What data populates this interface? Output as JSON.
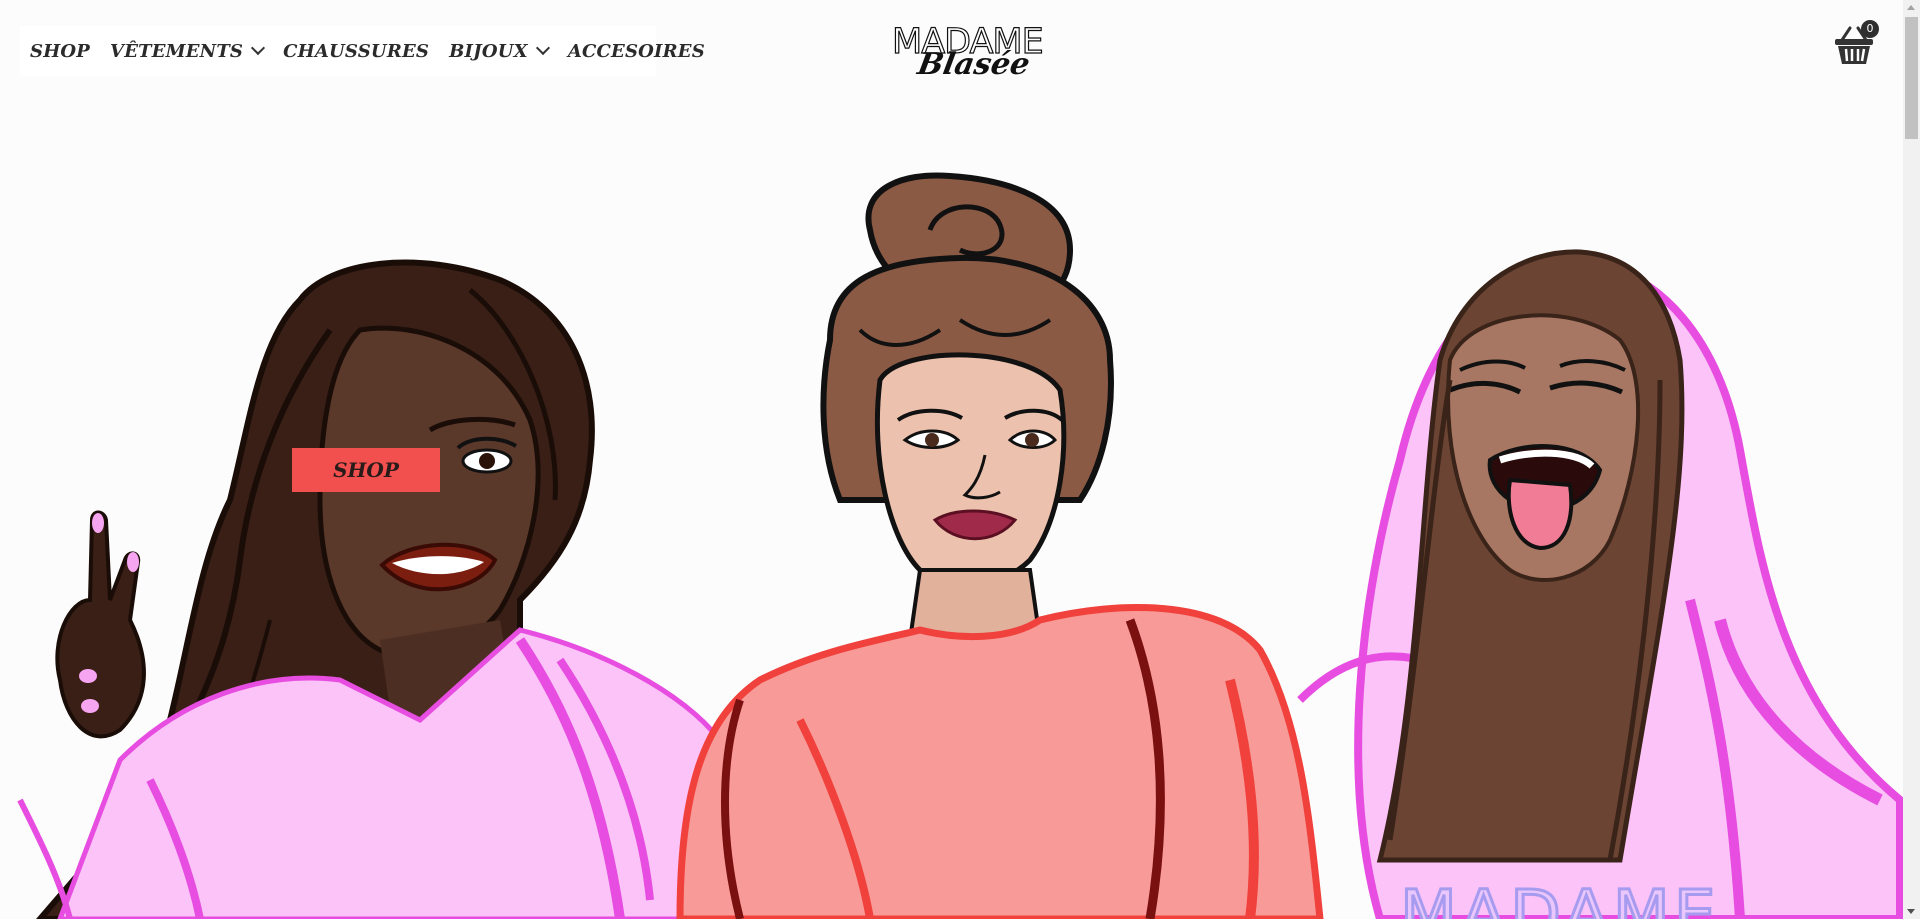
{
  "nav": {
    "items": [
      {
        "label": "SHOP",
        "has_dropdown": false
      },
      {
        "label": "VÊTEMENTS",
        "has_dropdown": true
      },
      {
        "label": "CHAUSSURES",
        "has_dropdown": false
      },
      {
        "label": "BIJOUX",
        "has_dropdown": true
      },
      {
        "label": "ACCESOIRES",
        "has_dropdown": false
      }
    ]
  },
  "logo": {
    "top": "MADAME",
    "script": "Blasée"
  },
  "cart": {
    "icon": "basket-icon",
    "count": "0"
  },
  "hero": {
    "cta_label": "SHOP",
    "hoodie_text": "MADAME"
  },
  "colors": {
    "accent": "#f2504e",
    "text": "#2b2b2b",
    "background": "#fcfcfc"
  }
}
